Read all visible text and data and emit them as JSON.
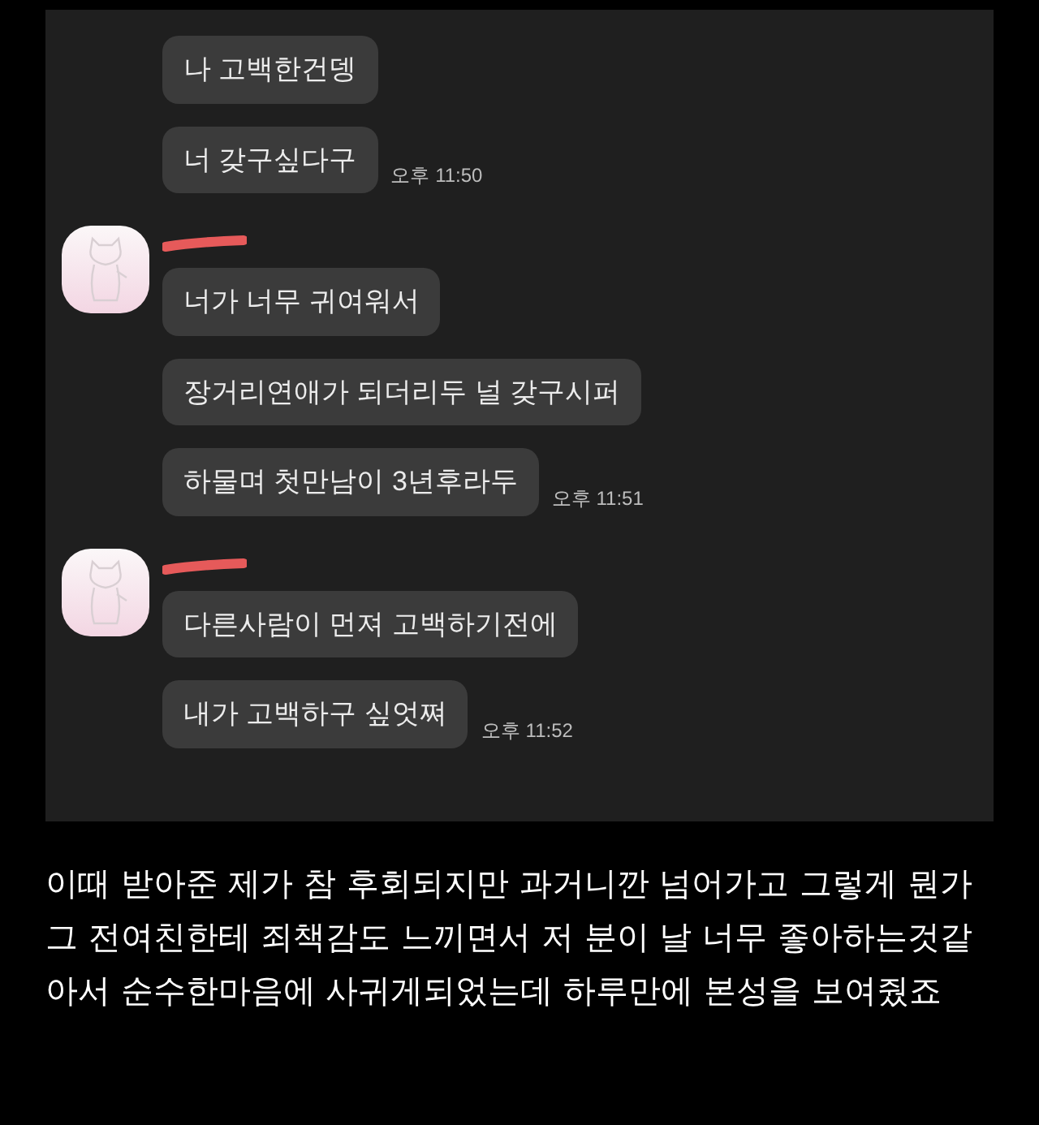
{
  "chat": {
    "groups": [
      {
        "avatar": false,
        "messages": [
          "나 고백한건뎅",
          "너 갖구싶다구"
        ],
        "time": "오후 11:50"
      },
      {
        "avatar": true,
        "messages": [
          "너가 너무 귀여워서",
          "장거리연애가 되더리두 널 갖구시퍼",
          "하물며 첫만남이 3년후라두"
        ],
        "time": "오후 11:51"
      },
      {
        "avatar": true,
        "messages": [
          "다른사람이 먼져 고백하기전에",
          "내가 고백하구 싶엇쪄"
        ],
        "time": "오후 11:52"
      }
    ]
  },
  "caption": "이때 받아준 제가 참 후회되지만 과거니깐 넘어가고 그렇게 뭔가 그 전여친한테 죄책감도 느끼면서 저 분이 날 너무 좋아하는것같아서 순수한마음에 사귀게되었는데 하루만에 본성을 보여줬죠"
}
